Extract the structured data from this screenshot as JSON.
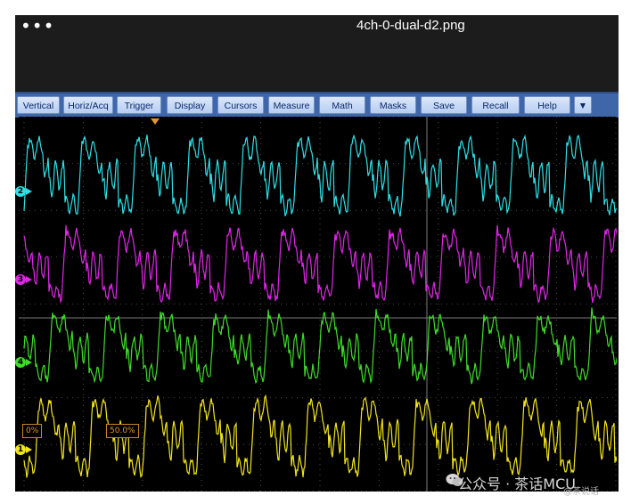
{
  "window": {
    "title": "4ch-0-dual-d2.png",
    "menu_dots": "•••"
  },
  "toolbar": {
    "items": [
      "Vertical",
      "Horiz/Acq",
      "Trigger",
      "Display",
      "Cursors",
      "Measure",
      "Math",
      "Masks",
      "Save",
      "Recall",
      "Help",
      "▼"
    ]
  },
  "channels": [
    {
      "id": "2",
      "color": "#2de0e6"
    },
    {
      "id": "3",
      "color": "#e026e8"
    },
    {
      "id": "4",
      "color": "#3fdc2a"
    },
    {
      "id": "1",
      "color": "#f2e51c"
    }
  ],
  "tags": {
    "left": "0%",
    "mid": "50.0%"
  },
  "watermark": {
    "text": "公众号 · 茶话MCU"
  },
  "footer": {
    "text": "@茶说话"
  },
  "colors": {
    "grid": "#4a4a4a",
    "accent": "#c8832a",
    "toolbar": "#3f66a8"
  }
}
